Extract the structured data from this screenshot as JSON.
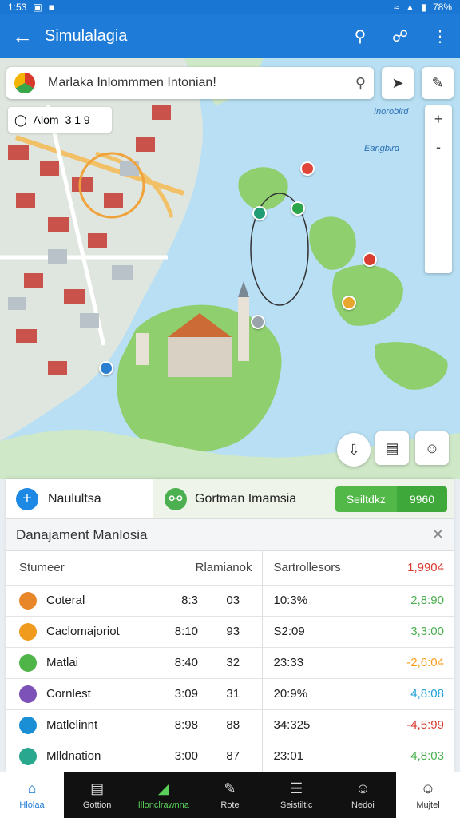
{
  "status": {
    "time": "1:53",
    "battery": "78%"
  },
  "appbar": {
    "title": "Simulalagia",
    "back_icon": "arrow-left-icon"
  },
  "search": {
    "value": "Marlaka Inlommmen Intonian!"
  },
  "map": {
    "scale_label": "Alom",
    "scale_value": "3 1 9",
    "labels": [
      "Inorobird",
      "Eangbird"
    ],
    "zoom": [
      "+",
      "-"
    ]
  },
  "sheet": {
    "tab1_label": "Naulultsa",
    "tab2_label": "Gortman Imamsia",
    "btn_a": "Seiltdkz",
    "btn_b": "9960",
    "heading": "Danajament Manlosia",
    "columns": [
      "Stumeer",
      "Rlamianok",
      "Sartrollesors",
      "1,9904"
    ],
    "rows": [
      {
        "name": "Coteral",
        "a": "8:3",
        "b": "03",
        "c": "10:3%",
        "d": "2,8:90",
        "color": "#e8872a",
        "dcolor": "#4caf50"
      },
      {
        "name": "Caclomajoriot",
        "a": "8:10",
        "b": "93",
        "c": "S2:09",
        "d": "3,3:00",
        "color": "#f19b1e",
        "dcolor": "#4caf50"
      },
      {
        "name": "Matlai",
        "a": "8:40",
        "b": "32",
        "c": "23:33",
        "d": "-2,6:04",
        "color": "#4fb548",
        "dcolor": "#f59c1a"
      },
      {
        "name": "Cornlest",
        "a": "3:09",
        "b": "31",
        "c": "20:9%",
        "d": "4,8:08",
        "color": "#7d52b8",
        "dcolor": "#1ea0d6"
      },
      {
        "name": "Matlelinnt",
        "a": "8:98",
        "b": "88",
        "c": "34:325",
        "d": "-4,5:99",
        "color": "#1b8fd6",
        "dcolor": "#d83a2e"
      },
      {
        "name": "Mlldnation",
        "a": "3:00",
        "b": "87",
        "c": "23:01",
        "d": "4,8:03",
        "color": "#2aa78f",
        "dcolor": "#4caf50"
      }
    ]
  },
  "nav": {
    "home": "Hlolaa",
    "items": [
      "Gottion",
      "Illonclrawnna",
      "Rote",
      "Seistiltic",
      "Nedoi"
    ],
    "last": "Mujtel"
  }
}
